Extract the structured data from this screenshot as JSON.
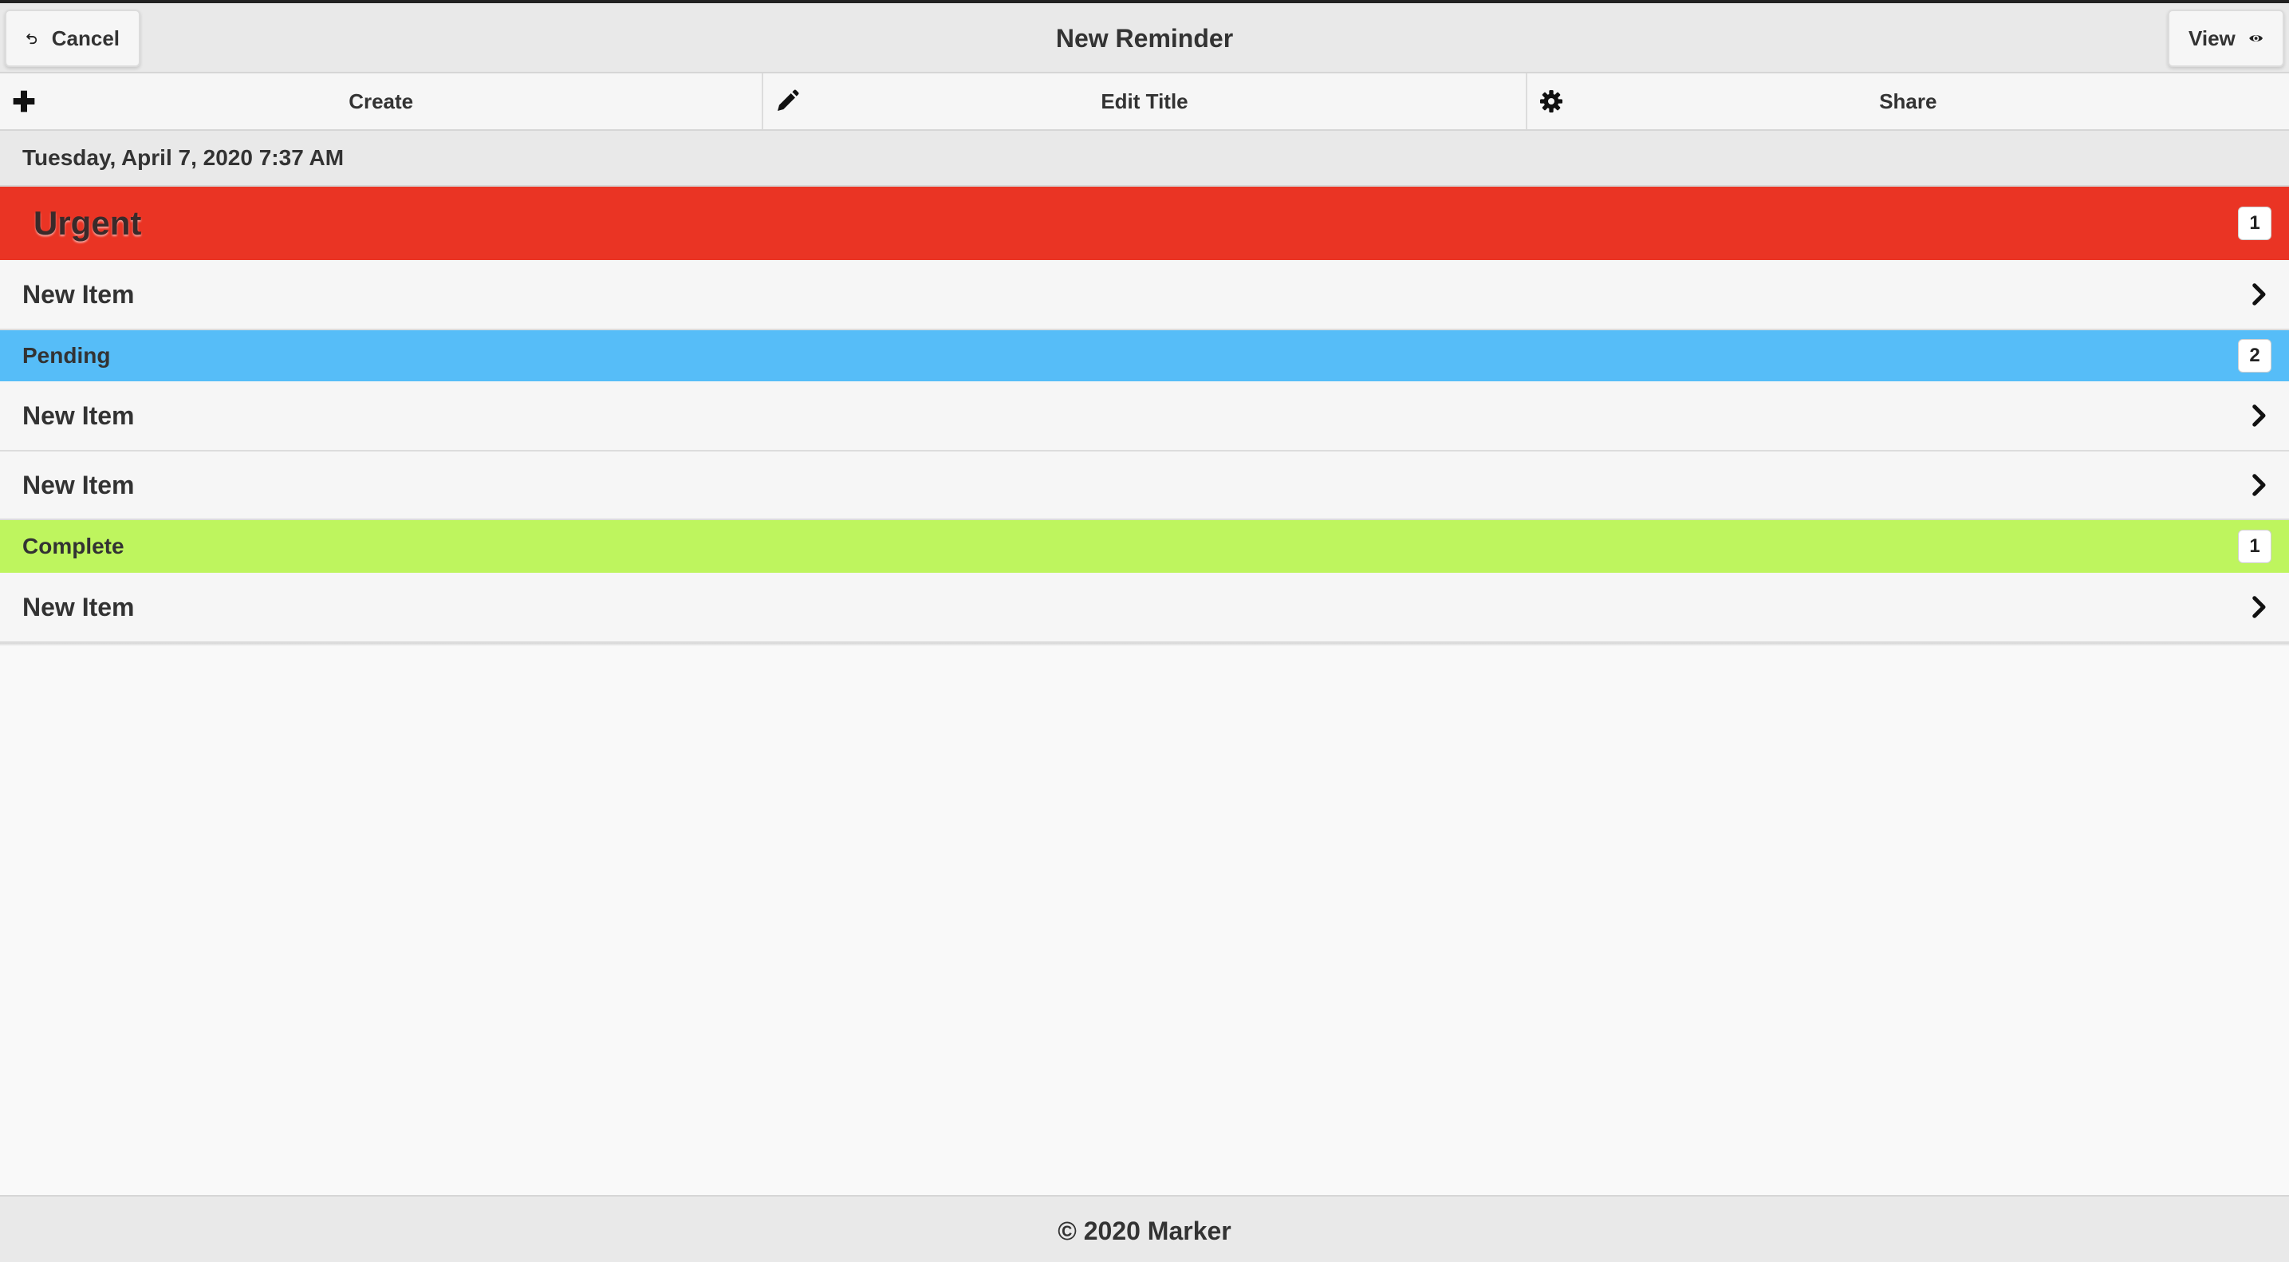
{
  "header": {
    "title": "New Reminder",
    "cancel_label": "Cancel",
    "cancel_icon": "undo-icon",
    "view_label": "View",
    "view_icon": "eye-icon"
  },
  "navbar": {
    "items": [
      {
        "label": "Create",
        "icon": "plus-icon"
      },
      {
        "label": "Edit Title",
        "icon": "pencil-icon"
      },
      {
        "label": "Share",
        "icon": "gear-icon"
      }
    ]
  },
  "date_label": "Tuesday, April 7, 2020 7:37 AM",
  "groups": [
    {
      "label": "Urgent",
      "count": "1",
      "color": "#ea3424",
      "items": [
        {
          "label": "New Item"
        }
      ]
    },
    {
      "label": "Pending",
      "count": "2",
      "color": "#56bdf8",
      "items": [
        {
          "label": "New Item"
        },
        {
          "label": "New Item"
        }
      ]
    },
    {
      "label": "Complete",
      "count": "1",
      "color": "#bef55e",
      "items": [
        {
          "label": "New Item"
        }
      ]
    }
  ],
  "footer": {
    "text": "© 2020 Marker"
  }
}
